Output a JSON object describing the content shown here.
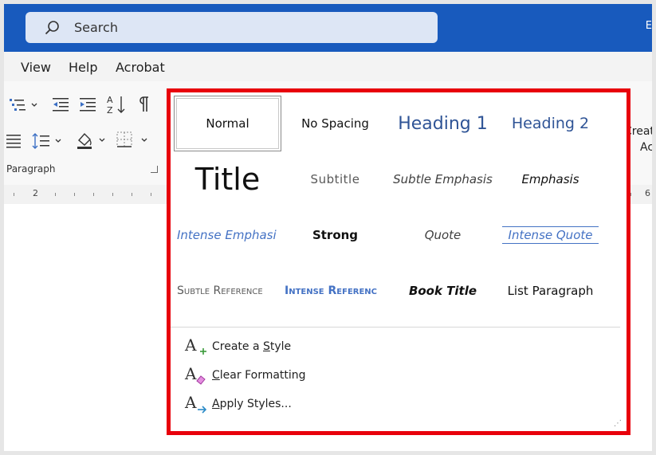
{
  "titlebar": {
    "search_label": "Search",
    "edge_text": "E"
  },
  "menubar": {
    "items": [
      "View",
      "Help",
      "Acrobat"
    ]
  },
  "ribbon": {
    "group_label": "Paragraph"
  },
  "ruler": {
    "left_num": "2",
    "right_num": "6"
  },
  "edge_command": {
    "line1": "Creat",
    "line2": "Ac"
  },
  "styles": [
    {
      "label": "Normal",
      "selected": true
    },
    {
      "label": "No Spacing"
    },
    {
      "label": "Heading 1"
    },
    {
      "label": "Heading 2"
    },
    {
      "label": "Title"
    },
    {
      "label": "Subtitle"
    },
    {
      "label": "Subtle Emphasis"
    },
    {
      "label": "Emphasis"
    },
    {
      "label": "Intense Emphasi"
    },
    {
      "label": "Strong"
    },
    {
      "label": "Quote"
    },
    {
      "label": "Intense Quote"
    },
    {
      "label": "Subtle Reference"
    },
    {
      "label": "Intense Referenc"
    },
    {
      "label": "Book Title"
    },
    {
      "label": "List Paragraph"
    }
  ],
  "commands": [
    {
      "pre": "Create a ",
      "key": "S",
      "post": "tyle",
      "icon": "create-style-icon"
    },
    {
      "pre": "",
      "key": "C",
      "post": "lear Formatting",
      "icon": "clear-formatting-icon"
    },
    {
      "pre": "",
      "key": "A",
      "post": "pply Styles...",
      "icon": "apply-styles-icon"
    }
  ],
  "colors": {
    "titlebar": "#185abd",
    "highlight_border": "#e8000b",
    "heading_blue": "#2f5496",
    "accent_blue": "#4472c4"
  }
}
